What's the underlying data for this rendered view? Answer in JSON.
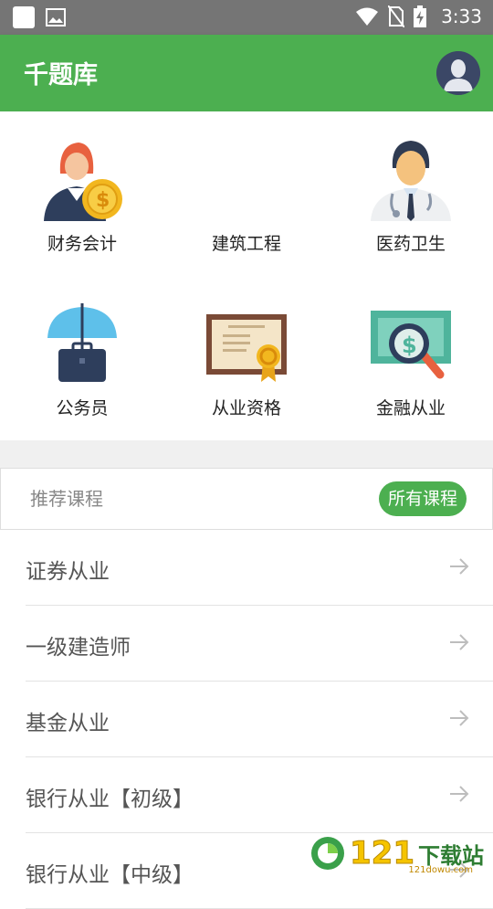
{
  "status_bar": {
    "time": "3:33"
  },
  "app_bar": {
    "title": "千题库"
  },
  "categories": [
    {
      "label": "财务会计",
      "icon": "accountant-icon"
    },
    {
      "label": "建筑工程",
      "icon": "construction-icon"
    },
    {
      "label": "医药卫生",
      "icon": "doctor-icon"
    },
    {
      "label": "公务员",
      "icon": "briefcase-umbrella-icon"
    },
    {
      "label": "从业资格",
      "icon": "certificate-icon"
    },
    {
      "label": "金融从业",
      "icon": "money-search-icon"
    }
  ],
  "recommend": {
    "title": "推荐课程",
    "all_button": "所有课程"
  },
  "courses": [
    {
      "label": "证券从业"
    },
    {
      "label": "一级建造师"
    },
    {
      "label": "基金从业"
    },
    {
      "label": "银行从业【初级】"
    },
    {
      "label": "银行从业【中级】"
    }
  ],
  "watermark": {
    "number": "121",
    "text": "下载站",
    "sub": "121dowu.com"
  },
  "colors": {
    "primary": "#4caf50",
    "status_bar": "#757575"
  }
}
